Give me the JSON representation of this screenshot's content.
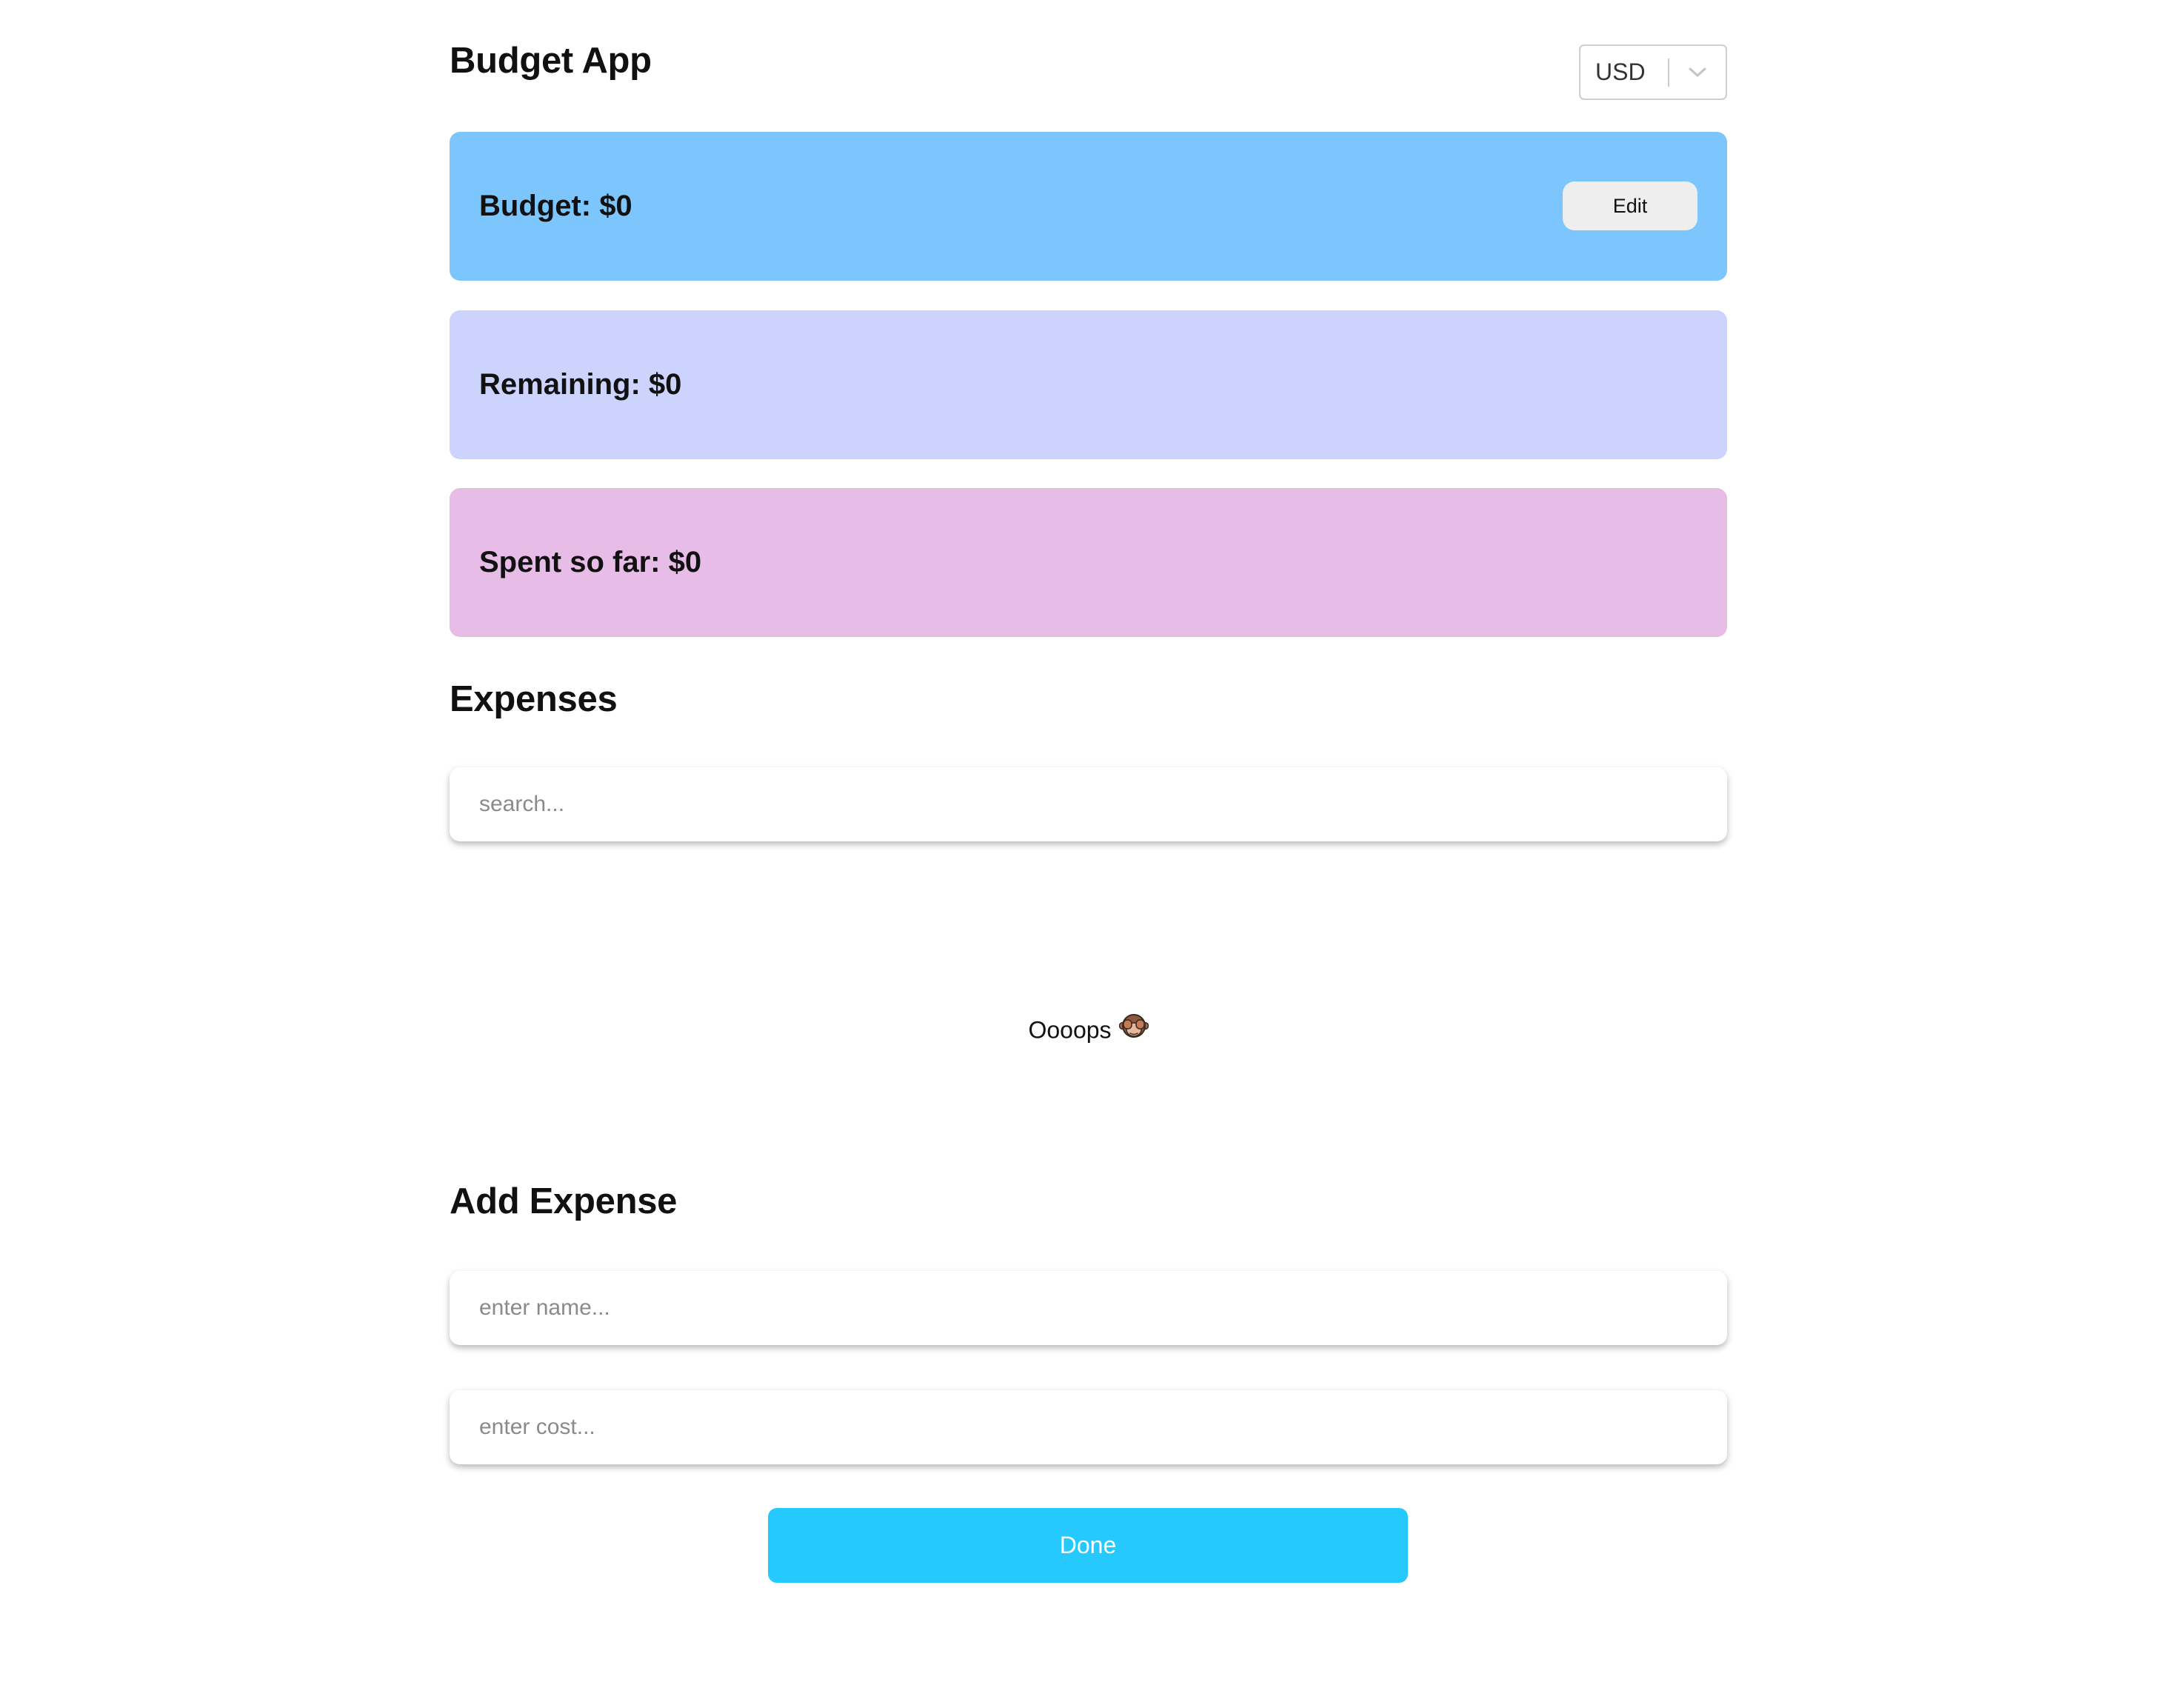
{
  "header": {
    "title": "Budget App",
    "currency": {
      "selected": "USD",
      "icon": "chevron-down-icon"
    }
  },
  "summary": {
    "budget": {
      "text": "Budget: $0",
      "edit_label": "Edit",
      "color": "#7cc6fd"
    },
    "remaining": {
      "text": "Remaining: $0",
      "color": "#ccd4fd"
    },
    "spent": {
      "text": "Spent so far: $0",
      "color": "#e7bce6"
    }
  },
  "expenses": {
    "title": "Expenses",
    "search_placeholder": "search...",
    "empty_message": "Oooops",
    "empty_icon": "see-no-evil-monkey-icon"
  },
  "add_expense": {
    "title": "Add Expense",
    "name_placeholder": "enter name...",
    "cost_placeholder": "enter cost...",
    "done_label": "Done",
    "done_color": "#26c9fd"
  }
}
